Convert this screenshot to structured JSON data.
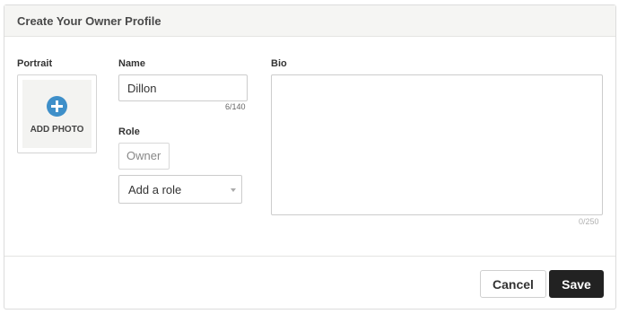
{
  "dialog": {
    "title": "Create Your Owner Profile"
  },
  "portrait": {
    "label": "Portrait",
    "add_photo_label": "ADD PHOTO",
    "icon": "plus-circle-icon",
    "icon_color": "#3e8fc9"
  },
  "name": {
    "label": "Name",
    "value": "Dillon",
    "counter": "6/140"
  },
  "role": {
    "label": "Role",
    "chip": "Owner",
    "select_value": "Add a role"
  },
  "bio": {
    "label": "Bio",
    "value": "",
    "counter": "0/250"
  },
  "footer": {
    "cancel_label": "Cancel",
    "save_label": "Save",
    "save_color": "#222222"
  }
}
